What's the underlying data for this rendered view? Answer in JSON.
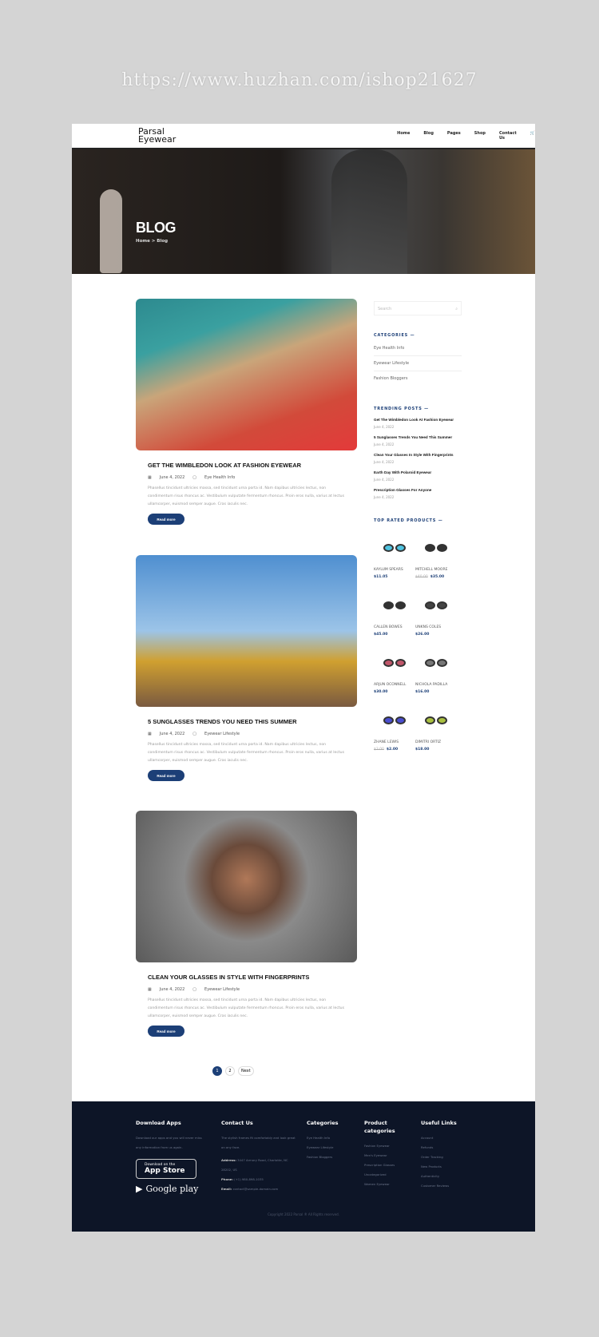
{
  "watermark": "https://www.huzhan.com/ishop21627",
  "header": {
    "logo_line1": "Parsal",
    "logo_line2": "Eyewear",
    "nav": [
      "Home",
      "Blog",
      "Pages",
      "Shop",
      "Contact Us"
    ],
    "cart_icon": "cart-icon"
  },
  "hero": {
    "title": "BLOG",
    "breadcrumb": "Home > Blog"
  },
  "posts": [
    {
      "title": "GET THE WIMBLEDON LOOK AT FASHION EYEWEAR",
      "date": "June 4, 2022",
      "category": "Eye Health Info",
      "excerpt": "Phasellus tincidunt ultricies massa, sed tincidunt urna porta id. Nam dapibus ultricies lectus, non condimentum risus rhoncus ac. Vestibulum vulputate fermentum rhoncus. Proin eros nulla, varius at lectus ullamcorper, euismod semper augue. Cras iaculis nec.",
      "button": "Read more"
    },
    {
      "title": "5 SUNGLASSES TRENDS YOU NEED THIS SUMMER",
      "date": "June 4, 2022",
      "category": "Eyewear Lifestyle",
      "excerpt": "Phasellus tincidunt ultricies massa, sed tincidunt urna porta id. Nam dapibus ultricies lectus, non condimentum risus rhoncus ac. Vestibulum vulputate fermentum rhoncus. Proin eros nulla, varius at lectus ullamcorper, euismod semper augue. Cras iaculis nec.",
      "button": "Read more"
    },
    {
      "title": "CLEAN YOUR GLASSES IN STYLE WITH FINGERPRINTS",
      "date": "June 4, 2022",
      "category": "Eyewear Lifestyle",
      "excerpt": "Phasellus tincidunt ultricies massa, sed tincidunt urna porta id. Nam dapibus ultricies lectus, non condimentum risus rhoncus ac. Vestibulum vulputate fermentum rhoncus. Proin eros nulla, varius at lectus ullamcorper, euismod semper augue. Cras iaculis nec.",
      "button": "Read more"
    }
  ],
  "pagination": {
    "pages": [
      "1",
      "2"
    ],
    "current": "1",
    "next": "Next"
  },
  "sidebar": {
    "search_placeholder": "Search",
    "categories_title": "CATEGORIES",
    "categories": [
      "Eye Health Info",
      "Eyewear Lifestyle",
      "Fashion Bloggers"
    ],
    "trending_title": "TRENDING POSTS",
    "trending": [
      {
        "title": "Get The Wimbledon Look At Fashion Eyewear",
        "date": "June 4, 2022"
      },
      {
        "title": "5 Sunglasses Trends You Need This Summer",
        "date": "June 4, 2022"
      },
      {
        "title": "Clean Your Glasses In Style With Fingerprints",
        "date": "June 4, 2022"
      },
      {
        "title": "Earth Day With Polaroid Eyewear",
        "date": "June 4, 2022"
      },
      {
        "title": "Prescription Glasses For Anyone",
        "date": "June 4, 2022"
      }
    ],
    "products_title": "TOP RATED PRODUCTS",
    "products": [
      {
        "name": "KAYLUM SPEARS",
        "old": "",
        "price": "$11.05",
        "lens": "#4fc3e0"
      },
      {
        "name": "MITCHELL MOORE",
        "old": "$40.00",
        "price": "$35.00",
        "lens": "#333333"
      },
      {
        "name": "CALLEN BOWES",
        "old": "",
        "price": "$45.00",
        "lens": "#333333"
      },
      {
        "name": "UNKNS COLES",
        "old": "",
        "price": "$26.00",
        "lens": "#444444"
      },
      {
        "name": "ARJUN OCONNELL",
        "old": "",
        "price": "$30.00",
        "lens": "#c0566a"
      },
      {
        "name": "NICHOLA PADILLA",
        "old": "",
        "price": "$16.00",
        "lens": "#777777"
      },
      {
        "name": "ZHANE LEWIS",
        "old": "$3.00",
        "price": "$2.00",
        "lens": "#4a4ed0"
      },
      {
        "name": "DIMITRI ORTIZ",
        "old": "",
        "price": "$18.00",
        "lens": "#a9c040"
      }
    ]
  },
  "footer": {
    "apps_title": "Download Apps",
    "apps_text": "Download our apps and you will never miss any information from us again.",
    "appstore_small": "Download on the",
    "appstore_big": "App Store",
    "googleplay": "Google play",
    "contact_title": "Contact Us",
    "contact_text": "The stylish frames fit comfortably and look great on any face.",
    "address_label": "Address:",
    "address": "3447 Armory Road, Charlotte, NC 28202, US",
    "phone_label": "Phone:",
    "phone": "(+1) 980-898-1035",
    "email_label": "Email:",
    "email": "contact@sample-domain.com",
    "categories_title": "Categories",
    "categories": [
      "Eye Health Info",
      "Eyewear Lifestyle",
      "Fashion Bloggers"
    ],
    "pcat_title": "Product categories",
    "pcats": [
      "Fashion Eyewear",
      "Men's Eyewear",
      "Prescription Glasses",
      "Uncategorized",
      "Women Eyewear"
    ],
    "links_title": "Useful Links",
    "links": [
      "Account",
      "Refunds",
      "Order Tracking",
      "New Products",
      "Authenticity",
      "Customer Reviews"
    ],
    "copyright": "Copyright 2022 Parsal ® All Rights reserved."
  },
  "colors": {
    "accent": "#1c3f77",
    "footer_bg": "#0d1527"
  }
}
